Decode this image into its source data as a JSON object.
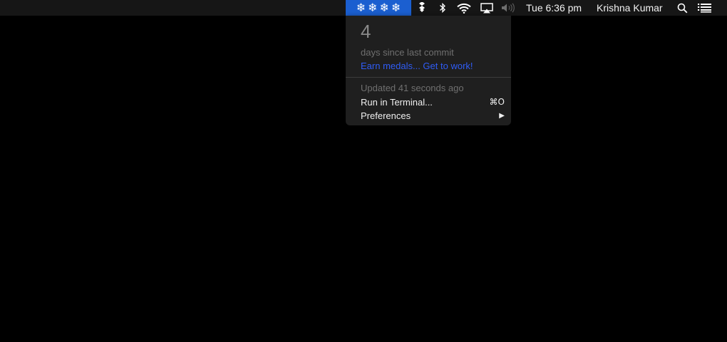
{
  "menubar": {
    "app_icon_glyphs": [
      "❄",
      "❄",
      "❄",
      "❄"
    ],
    "app_icon_name": "snowflake-icon",
    "highlight_color": "#1b5fd0",
    "status_icons": [
      "dropbox-icon",
      "bluetooth-icon",
      "wifi-icon",
      "airplay-icon",
      "volume-icon"
    ],
    "clock": "Tue 6:36 pm",
    "user_name": "Krishna Kumar",
    "search_icon": "search-icon",
    "notification_icon": "list-icon"
  },
  "dropdown": {
    "count": "4",
    "caption": "days since last commit",
    "link": "Earn medals... Get to work!",
    "link_color": "#2f5cf5",
    "updated": "Updated 41 seconds ago",
    "items": [
      {
        "label": "Run in Terminal...",
        "shortcut": "⌘O"
      },
      {
        "label": "Preferences",
        "submenu_arrow": "▶"
      }
    ]
  }
}
